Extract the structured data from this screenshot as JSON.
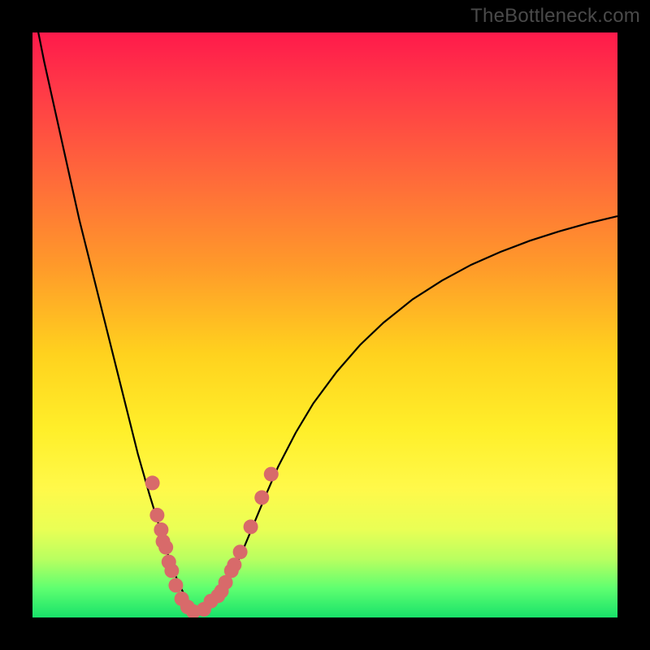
{
  "watermark": "TheBottleneck.com",
  "colors": {
    "frame": "#000000",
    "curve_stroke": "#000000",
    "dot_fill": "#d86a6a",
    "gradient_top": "#ff1a4b",
    "gradient_bottom": "#18e26a"
  },
  "chart_data": {
    "type": "line",
    "title": "",
    "xlabel": "",
    "ylabel": "",
    "xlim": [
      0,
      100
    ],
    "ylim": [
      0,
      100
    ],
    "x": [
      0,
      2,
      4,
      6,
      8,
      10,
      12,
      14,
      16,
      18,
      20,
      22,
      23,
      24,
      25,
      26,
      27,
      28,
      29,
      30,
      32,
      34,
      36,
      38,
      40,
      42,
      45,
      48,
      52,
      56,
      60,
      65,
      70,
      75,
      80,
      85,
      90,
      95,
      100
    ],
    "y": [
      105,
      95,
      86,
      77,
      68,
      60,
      52,
      44,
      36,
      28,
      21,
      14.5,
      11.2,
      8.3,
      5.8,
      3.8,
      2.3,
      1.4,
      1.0,
      1.4,
      3.6,
      7.2,
      11.6,
      16.4,
      21.2,
      25.8,
      31.6,
      36.6,
      42.0,
      46.6,
      50.4,
      54.4,
      57.6,
      60.3,
      62.5,
      64.4,
      66.0,
      67.4,
      68.6
    ],
    "annotations": [],
    "dots_left": [
      {
        "x": 20.5,
        "y": 23.0
      },
      {
        "x": 21.3,
        "y": 17.5
      },
      {
        "x": 22.0,
        "y": 15.0
      },
      {
        "x": 22.3,
        "y": 13.0
      },
      {
        "x": 22.8,
        "y": 12.0
      },
      {
        "x": 23.3,
        "y": 9.5
      },
      {
        "x": 23.8,
        "y": 8.0
      },
      {
        "x": 24.5,
        "y": 5.5
      },
      {
        "x": 25.5,
        "y": 3.2
      },
      {
        "x": 26.5,
        "y": 1.8
      },
      {
        "x": 27.5,
        "y": 1.0
      }
    ],
    "dots_right": [
      {
        "x": 29.3,
        "y": 1.4
      },
      {
        "x": 30.5,
        "y": 2.8
      },
      {
        "x": 31.7,
        "y": 3.7
      },
      {
        "x": 32.3,
        "y": 4.5
      },
      {
        "x": 33.0,
        "y": 6.0
      },
      {
        "x": 34.0,
        "y": 8.0
      },
      {
        "x": 34.5,
        "y": 9.0
      },
      {
        "x": 35.5,
        "y": 11.2
      },
      {
        "x": 37.3,
        "y": 15.5
      },
      {
        "x": 39.2,
        "y": 20.5
      },
      {
        "x": 40.8,
        "y": 24.5
      }
    ]
  }
}
